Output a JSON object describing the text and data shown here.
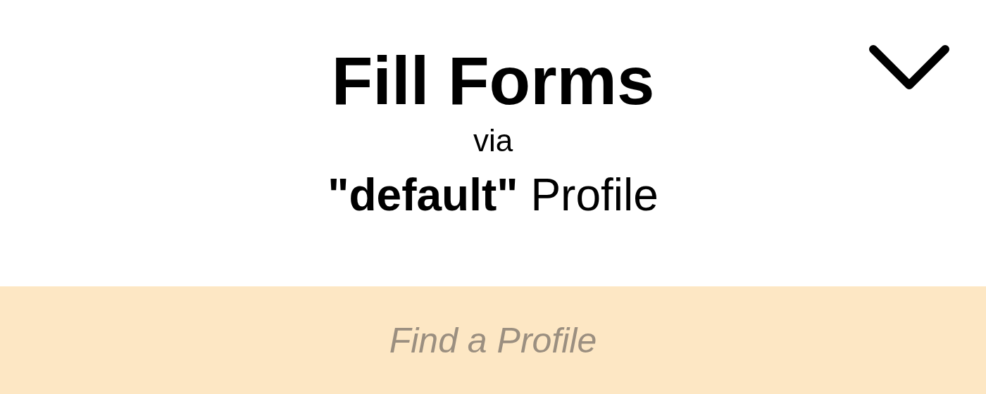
{
  "title": "Fill Forms",
  "connector": "via",
  "profile_line": "**\"default\"** Profile",
  "search": {
    "placeholder": "Find a Profile"
  }
}
